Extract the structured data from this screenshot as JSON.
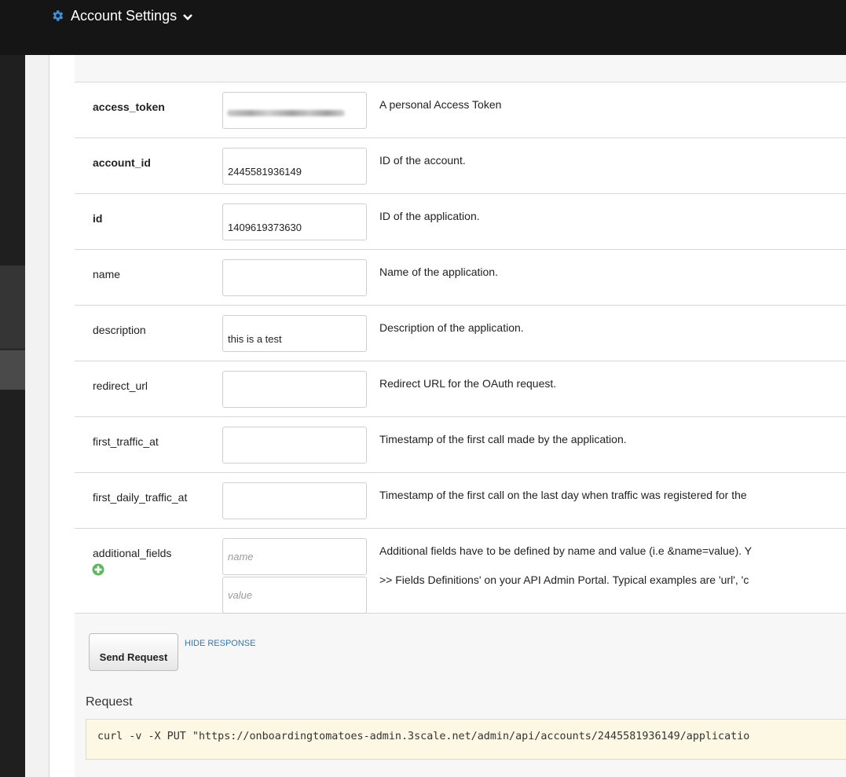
{
  "header": {
    "menu_label": "Account Settings",
    "gear_icon": "gear-icon",
    "chevron_icon": "chevron-down-icon"
  },
  "params": [
    {
      "name": "access_token",
      "required": true,
      "value": "",
      "masked": true,
      "description": "A personal Access Token"
    },
    {
      "name": "account_id",
      "required": true,
      "value": "2445581936149",
      "description": "ID of the account."
    },
    {
      "name": "id",
      "required": true,
      "value": "1409619373630",
      "description": "ID of the application."
    },
    {
      "name": "name",
      "required": false,
      "value": "",
      "description": "Name of the application."
    },
    {
      "name": "description",
      "required": false,
      "value": "this is a test",
      "description": "Description of the application."
    },
    {
      "name": "redirect_url",
      "required": false,
      "value": "",
      "description": "Redirect URL for the OAuth request."
    },
    {
      "name": "first_traffic_at",
      "required": false,
      "value": "",
      "description": "Timestamp of the first call made by the application."
    },
    {
      "name": "first_daily_traffic_at",
      "required": false,
      "value": "",
      "description": "Timestamp of the first call on the last day when traffic was registered for the"
    }
  ],
  "additional_fields": {
    "name": "additional_fields",
    "add_icon": "plus-circle-icon",
    "name_placeholder": "name",
    "value_placeholder": "value",
    "description_line1": "Additional fields have to be defined by name and value (i.e &name=value). Y",
    "description_line2": ">> Fields Definitions' on your API Admin Portal. Typical examples are 'url', 'c"
  },
  "actions": {
    "send_label": "Send Request",
    "hide_response_label": "HIDE RESPONSE"
  },
  "request": {
    "heading": "Request",
    "command": "curl -v  -X PUT \"https://onboardingtomatoes-admin.3scale.net/admin/api/accounts/2445581936149/applicatio"
  }
}
